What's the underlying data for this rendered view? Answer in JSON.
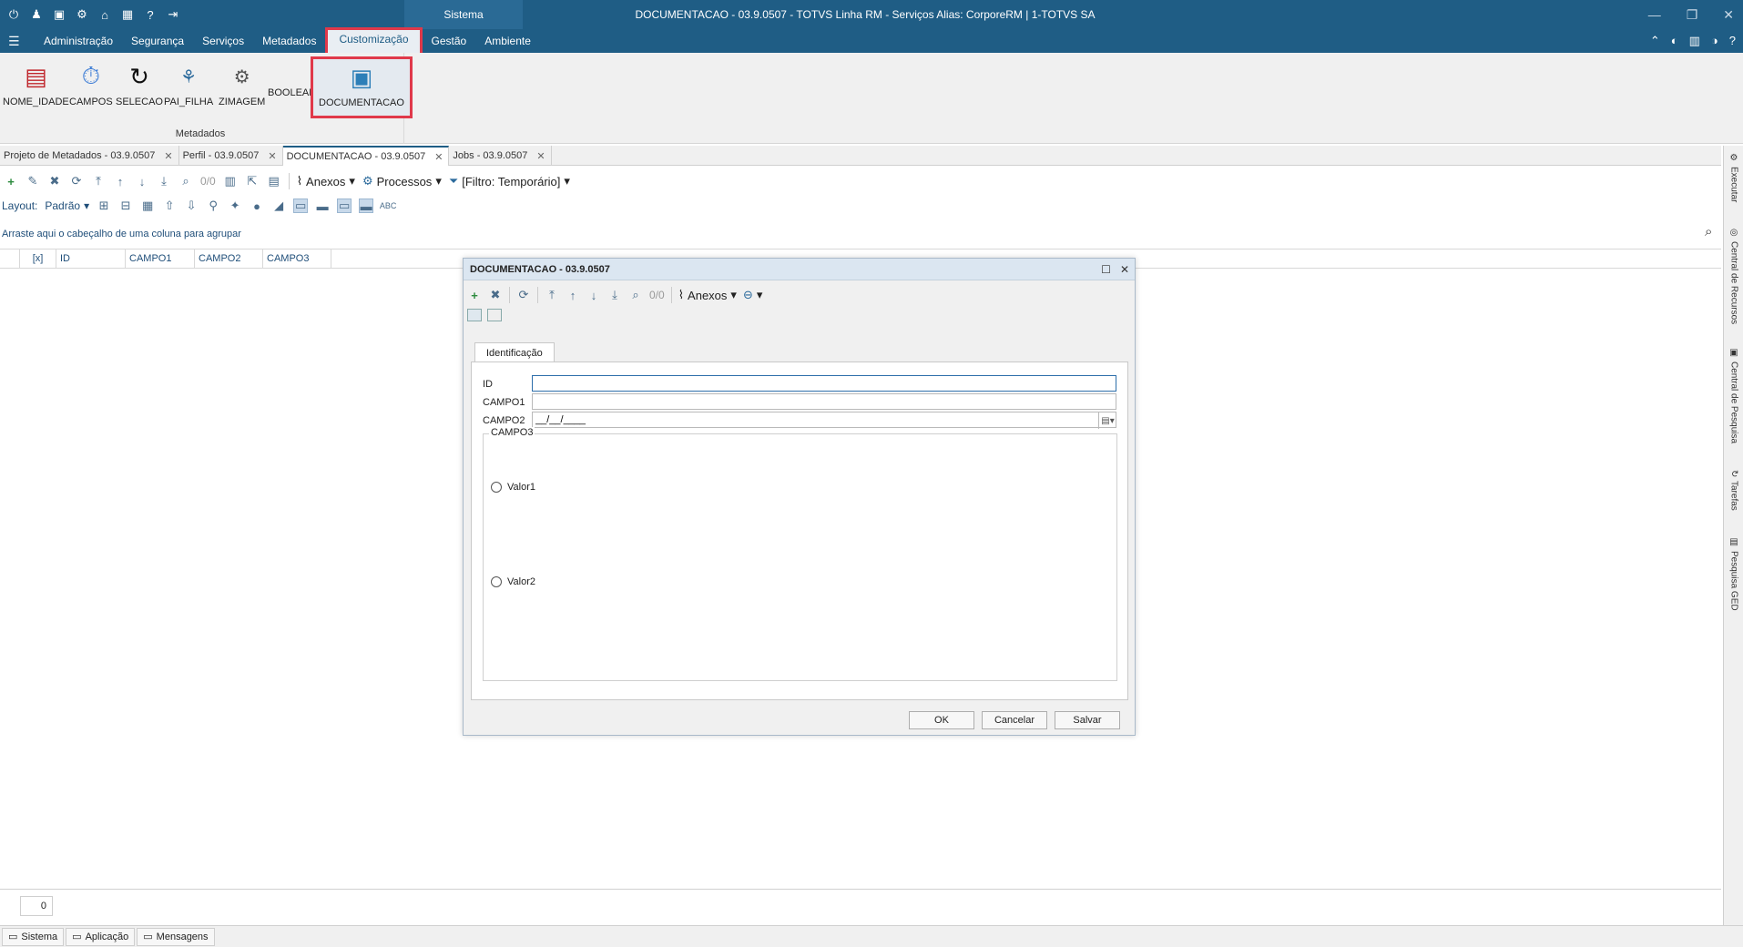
{
  "window": {
    "title": "DOCUMENTACAO - 03.9.0507 - TOTVS Linha RM - Serviços  Alias: CorporeRM | 1-TOTVS SA",
    "system_tab": "Sistema"
  },
  "menu": {
    "items": [
      "Administração",
      "Segurança",
      "Serviços",
      "Metadados",
      "Customização",
      "Gestão",
      "Ambiente"
    ],
    "active": "Customização"
  },
  "ribbon": {
    "buttons": [
      "NOME_IDADE",
      "CAMPOS",
      "SELECAO",
      "PAI_FILHA",
      "ZIMAGEM",
      "BOOLEAN",
      "DOCUMENTACAO"
    ],
    "selected": "DOCUMENTACAO",
    "group_label": "Metadados"
  },
  "doc_tabs": [
    {
      "label": "Projeto de Metadados - 03.9.0507",
      "active": false
    },
    {
      "label": "Perfil - 03.9.0507",
      "active": false
    },
    {
      "label": "DOCUMENTACAO - 03.9.0507",
      "active": true
    },
    {
      "label": "Jobs - 03.9.0507",
      "active": false
    }
  ],
  "toolbar": {
    "count": "0/0",
    "anexos": "Anexos",
    "processos": "Processos",
    "filtro": "[Filtro: Temporário]"
  },
  "layout": {
    "label": "Layout:",
    "value": "Padrão"
  },
  "grid": {
    "group_hint": "Arraste aqui o cabeçalho de uma coluna para agrupar",
    "columns": [
      "[x]",
      "ID",
      "CAMPO1",
      "CAMPO2",
      "CAMPO3"
    ],
    "record_count": "0"
  },
  "side_rail": [
    "Executar",
    "Central de Recursos",
    "Central de Pesquisa",
    "Tarefas",
    "Pesquisa GED"
  ],
  "status_tabs": [
    "Sistema",
    "Aplicação",
    "Mensagens"
  ],
  "dialog": {
    "title": "DOCUMENTACAO - 03.9.0507",
    "count": "0/0",
    "anexos": "Anexos",
    "tab": "Identificação",
    "fields": {
      "id_label": "ID",
      "id_value": "",
      "campo1_label": "CAMPO1",
      "campo1_value": "",
      "campo2_label": "CAMPO2",
      "campo2_value": "__/__/____"
    },
    "campo3": {
      "title": "CAMPO3",
      "options": [
        "Valor1",
        "Valor2"
      ]
    },
    "buttons": {
      "ok": "OK",
      "cancel": "Cancelar",
      "save": "Salvar"
    }
  },
  "colors": {
    "titlebar": "#1f5d85",
    "highlight": "#e0394a",
    "link": "#1f4e79"
  }
}
